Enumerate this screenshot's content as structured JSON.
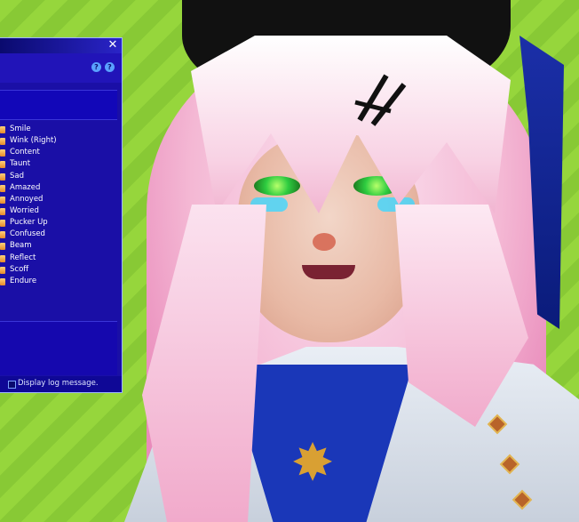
{
  "window": {
    "close_glyph": "✕",
    "help_buttons": [
      "?",
      "?"
    ]
  },
  "emotes": [
    {
      "label": "Smile"
    },
    {
      "label": "Wink (Right)"
    },
    {
      "label": "Content"
    },
    {
      "label": "Taunt"
    },
    {
      "label": "Sad"
    },
    {
      "label": "Amazed"
    },
    {
      "label": "Annoyed"
    },
    {
      "label": "Worried"
    },
    {
      "label": "Pucker Up"
    },
    {
      "label": "Confused"
    },
    {
      "label": "Beam"
    },
    {
      "label": "Reflect"
    },
    {
      "label": "Scoff"
    },
    {
      "label": "Endure"
    }
  ],
  "footer": {
    "checkbox_label": "Display log message."
  },
  "colors": {
    "window_bg": "#1a0fa6",
    "background": "#8fd13a"
  }
}
